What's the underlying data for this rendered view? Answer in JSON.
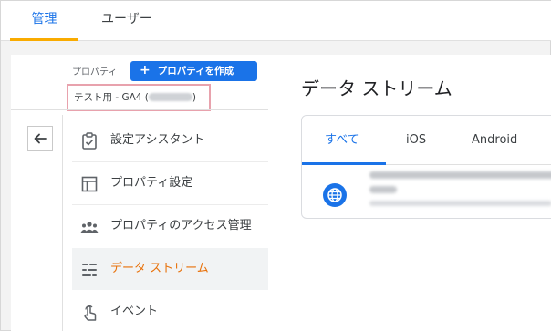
{
  "top_tabs": {
    "admin": "管理",
    "users": "ユーザー"
  },
  "left_panel": {
    "property_label": "プロパティ",
    "create_button": {
      "icon": "plus-icon",
      "label": "プロパティを作成"
    },
    "property_selector": {
      "value_prefix": "テスト用 - GA4 (",
      "value_suffix": ")"
    },
    "back_button_icon": "arrow-left-icon",
    "nav_items": [
      {
        "label": "設定アシスタント",
        "icon": "clipboard-check-icon",
        "active": false
      },
      {
        "label": "プロパティ設定",
        "icon": "layout-icon",
        "active": false
      },
      {
        "label": "プロパティのアクセス管理",
        "icon": "people-icon",
        "active": false
      },
      {
        "label": "データ ストリーム",
        "icon": "data-stream-icon",
        "active": true
      },
      {
        "label": "イベント",
        "icon": "touch-icon",
        "active": false
      }
    ]
  },
  "right_panel": {
    "title": "データ ストリーム",
    "tabs": [
      {
        "label": "すべて",
        "active": true
      },
      {
        "label": "iOS",
        "active": false
      },
      {
        "label": "Android",
        "active": false
      }
    ],
    "stream_icon": "globe-icon"
  },
  "colors": {
    "accent_blue": "#1a73e8",
    "active_orange": "#e8710a",
    "tab_underline": "#f9ab00",
    "highlight_border": "#e8a2ad"
  }
}
